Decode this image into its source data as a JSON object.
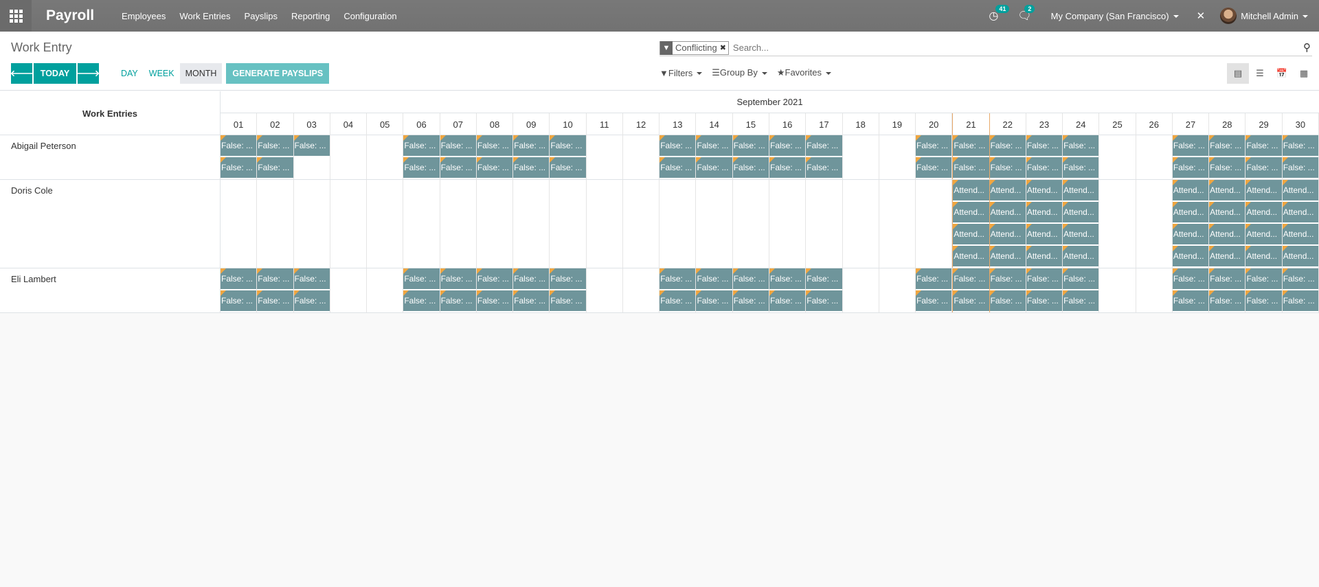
{
  "navbar": {
    "brand": "Payroll",
    "menu": [
      "Employees",
      "Work Entries",
      "Payslips",
      "Reporting",
      "Configuration"
    ],
    "activity_count": "41",
    "messages_count": "2",
    "company": "My Company (San Francisco)",
    "user": "Mitchell Admin"
  },
  "control_panel": {
    "breadcrumb": "Work Entry",
    "facet_label": "Conflicting",
    "search_placeholder": "Search...",
    "today_label": "TODAY",
    "scales": [
      "DAY",
      "WEEK",
      "MONTH"
    ],
    "active_scale": "MONTH",
    "generate_label": "GENERATE PAYSLIPS",
    "filters_label": "Filters",
    "groupby_label": "Group By",
    "favorites_label": "Favorites"
  },
  "gantt": {
    "title": "Work Entries",
    "month": "September 2021",
    "days": [
      "01",
      "02",
      "03",
      "04",
      "05",
      "06",
      "07",
      "08",
      "09",
      "10",
      "11",
      "12",
      "13",
      "14",
      "15",
      "16",
      "17",
      "18",
      "19",
      "20",
      "21",
      "22",
      "23",
      "24",
      "25",
      "26",
      "27",
      "28",
      "29",
      "30"
    ],
    "today_index": 20,
    "rows": [
      {
        "name": "Abigail Peterson",
        "height": 2,
        "cells": [
          [
            "False: ...",
            "False: ..."
          ],
          [
            "False: ...",
            "False: ..."
          ],
          [
            "False: ..."
          ],
          [],
          [],
          [
            "False: ...",
            "False: ..."
          ],
          [
            "False: ...",
            "False: ..."
          ],
          [
            "False: ...",
            "False: ..."
          ],
          [
            "False: ...",
            "False: ..."
          ],
          [
            "False: ...",
            "False: ..."
          ],
          [],
          [],
          [
            "False: ...",
            "False: ..."
          ],
          [
            "False: ...",
            "False: ..."
          ],
          [
            "False: ...",
            "False: ..."
          ],
          [
            "False: ...",
            "False: ..."
          ],
          [
            "False: ...",
            "False: ..."
          ],
          [],
          [],
          [
            "False: ...",
            "False: ..."
          ],
          [
            "False: ...",
            "False: ..."
          ],
          [
            "False: ...",
            "False: ..."
          ],
          [
            "False: ...",
            "False: ..."
          ],
          [
            "False: ...",
            "False: ..."
          ],
          [],
          [],
          [
            "False: ...",
            "False: ..."
          ],
          [
            "False: ...",
            "False: ..."
          ],
          [
            "False: ...",
            "False: ..."
          ],
          [
            "False: ...",
            "False: ..."
          ]
        ]
      },
      {
        "name": "Doris Cole",
        "height": 4,
        "cells": [
          [],
          [],
          [],
          [],
          [],
          [],
          [],
          [],
          [],
          [],
          [],
          [],
          [],
          [],
          [],
          [],
          [],
          [],
          [],
          [],
          [
            "Attend...",
            "Attend...",
            "Attend...",
            "Attend..."
          ],
          [
            "Attend...",
            "Attend...",
            "Attend...",
            "Attend..."
          ],
          [
            "Attend...",
            "Attend...",
            "Attend...",
            "Attend..."
          ],
          [
            "Attend...",
            "Attend...",
            "Attend...",
            "Attend..."
          ],
          [],
          [],
          [
            "Attend...",
            "Attend...",
            "Attend...",
            "Attend..."
          ],
          [
            "Attend...",
            "Attend...",
            "Attend...",
            "Attend..."
          ],
          [
            "Attend...",
            "Attend...",
            "Attend...",
            "Attend..."
          ],
          [
            "Attend...",
            "Attend...",
            "Attend...",
            "Attend..."
          ]
        ]
      },
      {
        "name": "Eli Lambert",
        "height": 2,
        "cells": [
          [
            "False: ...",
            "False: ..."
          ],
          [
            "False: ...",
            "False: ..."
          ],
          [
            "False: ...",
            "False: ..."
          ],
          [],
          [],
          [
            "False: ...",
            "False: ..."
          ],
          [
            "False: ...",
            "False: ..."
          ],
          [
            "False: ...",
            "False: ..."
          ],
          [
            "False: ...",
            "False: ..."
          ],
          [
            "False: ...",
            "False: ..."
          ],
          [],
          [],
          [
            "False: ...",
            "False: ..."
          ],
          [
            "False: ...",
            "False: ..."
          ],
          [
            "False: ...",
            "False: ..."
          ],
          [
            "False: ...",
            "False: ..."
          ],
          [
            "False: ...",
            "False: ..."
          ],
          [],
          [],
          [
            "False: ...",
            "False: ..."
          ],
          [
            "False: ...",
            "False: ..."
          ],
          [
            "False: ...",
            "False: ..."
          ],
          [
            "False: ...",
            "False: ..."
          ],
          [
            "False: ...",
            "False: ..."
          ],
          [],
          [],
          [
            "False: ...",
            "False: ..."
          ],
          [
            "False: ...",
            "False: ..."
          ],
          [
            "False: ...",
            "False: ..."
          ],
          [
            "False: ...",
            "False: ..."
          ]
        ]
      }
    ]
  },
  "colors": {
    "accent": "#00a09d",
    "pill": "#6f959b",
    "corner": "#f0a640",
    "today_line": "#e8a96a"
  }
}
